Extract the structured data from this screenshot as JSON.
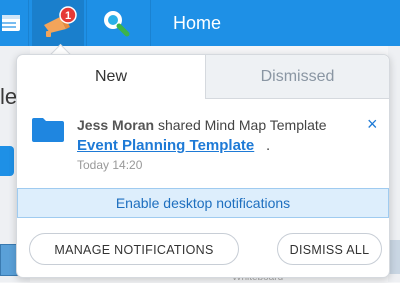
{
  "topbar": {
    "home_label": "Home",
    "badge_count": "1",
    "icons": [
      "calendar-icon",
      "notifications-megaphone-icon",
      "search-icon"
    ]
  },
  "background": {
    "partial_heading": "le",
    "partial_footer": "Whiteboard"
  },
  "popup": {
    "tabs": [
      {
        "label": "New",
        "active": true
      },
      {
        "label": "Dismissed",
        "active": false
      }
    ],
    "notification": {
      "icon": "folder-icon",
      "user": "Jess Moran",
      "action": "shared Mind Map Template",
      "link": "Event Planning Template",
      "link_suffix": ".",
      "time": "Today 14:20",
      "close": "×"
    },
    "enable_desktop": "Enable desktop notifications",
    "manage_button": "MANAGE NOTIFICATIONS",
    "dismiss_all_button": "DISMISS ALL"
  },
  "colors": {
    "topbar": "#1e90e6",
    "accent": "#1e7ad6",
    "badge": "#e53935",
    "enable_bar_bg": "#ddeefc"
  }
}
